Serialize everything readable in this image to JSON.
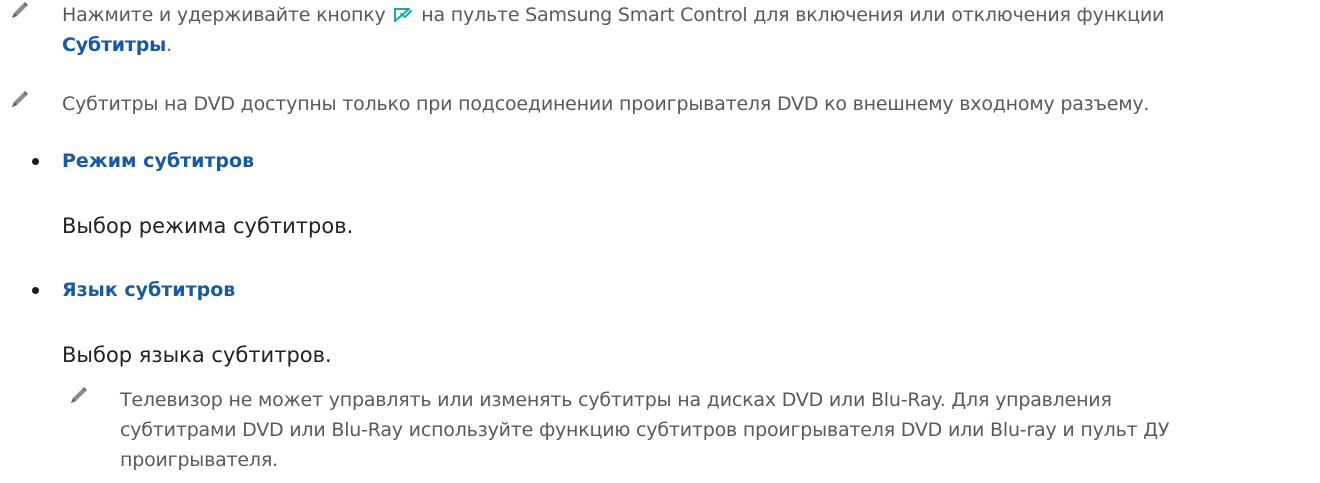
{
  "notes": [
    {
      "text_before": "Нажмите и удерживайте кнопку",
      "text_after": "на пульте Samsung Smart Control для включения или отключения функции",
      "highlight": "Субтитры",
      "suffix": ".",
      "inline_icon": "subtitle-cc-icon"
    },
    {
      "text": "Субтитры на DVD доступны только при подсоединении проигрывателя DVD ко внешнему входному разъему."
    }
  ],
  "items": [
    {
      "title": "Режим субтитров",
      "description": "Выбор режима субтитров."
    },
    {
      "title": "Язык субтитров",
      "description": "Выбор языка субтитров."
    }
  ],
  "sub_note": {
    "line1": "Телевизор не может управлять или изменять субтитры на дисках DVD или Blu-Ray. Для управления",
    "line2": "субтитрами DVD или Blu-Ray используйте функцию субтитров проигрывателя DVD или Blu-ray и пульт ДУ",
    "line3": "проигрывателя."
  },
  "colors": {
    "accent": "#1a5aa0",
    "icon": "#1fa8a8"
  },
  "icons": {
    "note": "pencil-icon",
    "bullet": "bullet-icon"
  }
}
